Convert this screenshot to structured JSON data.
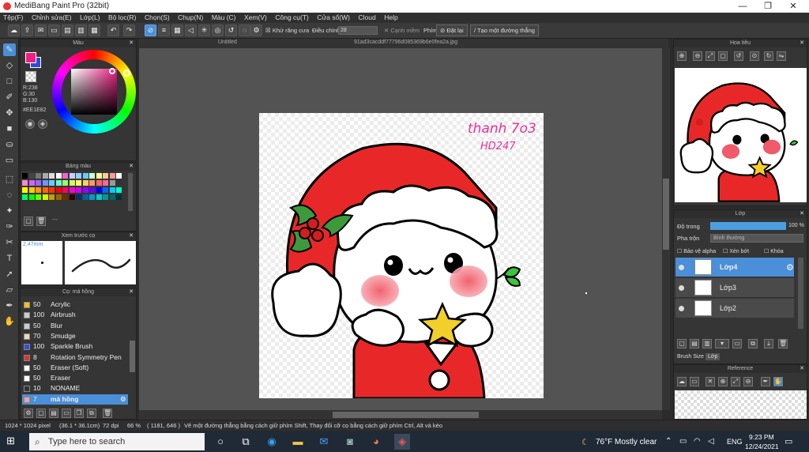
{
  "window": {
    "title": "MediBang Paint Pro (32bit)",
    "minimize": "—",
    "maximize": "❐",
    "close": "✕"
  },
  "menu": [
    "Tệp(F)",
    "Chỉnh sửa(E)",
    "Lớp(L)",
    "Bộ lọc(R)",
    "Chọn(S)",
    "Chụp(N)",
    "Màu (C)",
    "Xem(V)",
    "Công cụ(T)",
    "Cửa sổ(W)",
    "Cloud",
    "Help"
  ],
  "toolbar": {
    "antialias_label": "Khử răng cưa",
    "adjust_label": "Điều chỉnh",
    "adjust_value": "28",
    "soft_edge_label": "Cạnh mềm",
    "key_label": "Phím",
    "reset_label": "Đặt lại",
    "straight_line_label": "Tạo một đường thẳng"
  },
  "tabs": {
    "untitled": "Untitled",
    "file": "91ad3cacddf77796d085369b6e0fea2a.jpg"
  },
  "color_panel": {
    "title": "Màu",
    "r": "R:238",
    "g": "G:30",
    "b": "B:130",
    "hex": "#EE1E82",
    "fg_color": "#ee1e82",
    "bg_color": "#2a4fd6"
  },
  "palette_panel": {
    "title": "Bảng màu",
    "dash": "---"
  },
  "preview_panel": {
    "title": "Xem trước cọ",
    "size": "2.47mm"
  },
  "brush_panel": {
    "title": "Cọ: má hồng",
    "brushes": [
      {
        "size": "50",
        "name": "Acrylic",
        "color": "#f0c020"
      },
      {
        "size": "100",
        "name": "Airbrush",
        "color": "#cccccc"
      },
      {
        "size": "50",
        "name": "Blur",
        "color": "#cccccc"
      },
      {
        "size": "70",
        "name": "Smudge",
        "color": "#f0d8b0"
      },
      {
        "size": "100",
        "name": "Sparkle Brush",
        "color": "#3050e0"
      },
      {
        "size": "8",
        "name": "Rotation Symmetry Pen",
        "color": "#e03030"
      },
      {
        "size": "50",
        "name": "Eraser (Soft)",
        "color": "#ffffff"
      },
      {
        "size": "50",
        "name": "Eraser",
        "color": "#ffffff"
      },
      {
        "size": "10",
        "name": "NONAME",
        "color": "#333333"
      },
      {
        "size": "7",
        "name": "má hồng",
        "color": "#f4a0a0",
        "selected": true
      }
    ]
  },
  "navigator_panel": {
    "title": "Hoa tiêu"
  },
  "layer_panel": {
    "title": "Lớp",
    "opacity_label": "Độ trong",
    "opacity_value": "100 %",
    "opacity_fraction": 1.0,
    "blend_label": "Pha trộn",
    "blend_value": "Bình thường",
    "protect_alpha": "Bảo vệ alpha",
    "clip": "Xén bớt",
    "lock": "Khóa",
    "layers": [
      {
        "name": "Lớp4",
        "selected": true
      },
      {
        "name": "Lớp3",
        "selected": false
      },
      {
        "name": "Lớp2",
        "selected": false
      }
    ],
    "brush_size_label": "Brush Size",
    "layer_tab": "Lớp"
  },
  "reference_panel": {
    "title": "Reference"
  },
  "canvas": {
    "signature_line1": "thanh 7o3",
    "signature_line2": "HD247"
  },
  "statusbar": {
    "size": "1024 * 1024 pixel",
    "cm": "(36.1 * 36.1cm)",
    "dpi": "72 dpi",
    "zoom": "66 %",
    "coords": "( 1181, 646 )",
    "hint": "Vẽ một đường thẳng bằng cách giữ phím Shift, Thay đổi cỡ cọ bằng cách giữ phím Ctrl, Alt và kéo"
  },
  "taskbar": {
    "search_placeholder": "Type here to search",
    "weather": "76°F  Mostly clear",
    "lang": "ENG",
    "time": "9:23 PM",
    "date": "12/24/2021"
  }
}
